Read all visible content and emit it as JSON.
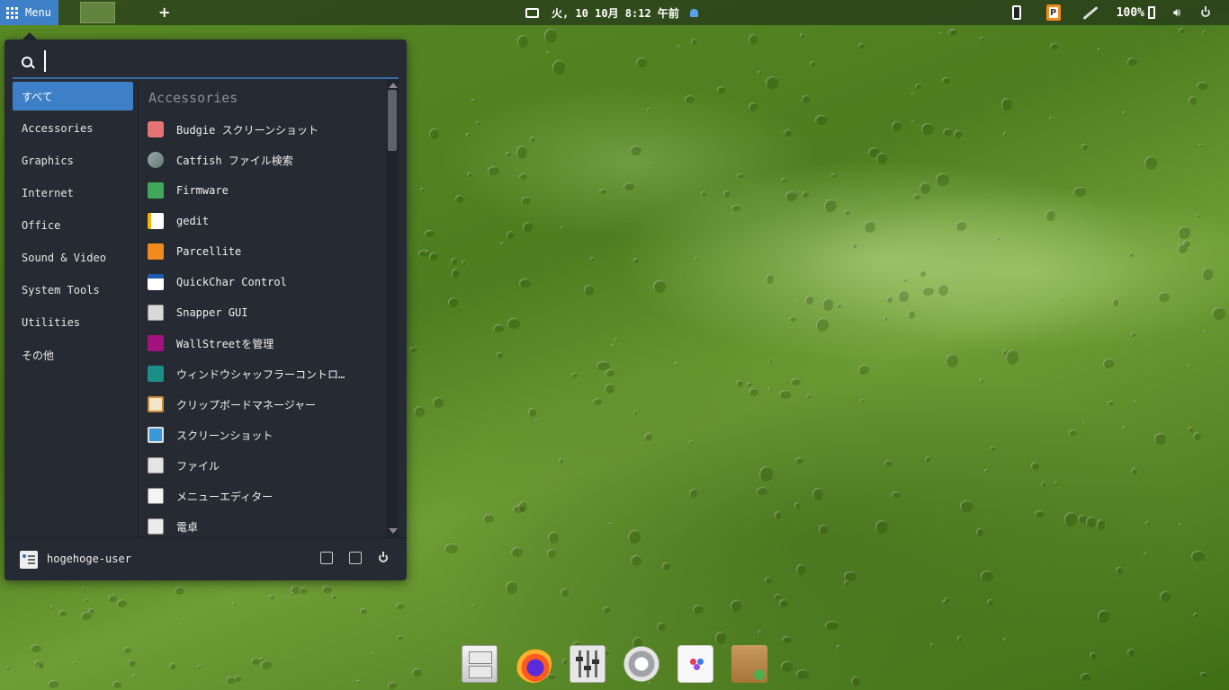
{
  "top_panel": {
    "menu_label": "Menu",
    "clock_text": "火, 10 10月  8:12 午前",
    "battery_text": "100%"
  },
  "menu": {
    "search_placeholder": "",
    "categories": [
      {
        "label": "すべて",
        "active": true
      },
      {
        "label": "Accessories"
      },
      {
        "label": "Graphics"
      },
      {
        "label": "Internet"
      },
      {
        "label": "Office"
      },
      {
        "label": "Sound & Video"
      },
      {
        "label": "System Tools"
      },
      {
        "label": "Utilities"
      },
      {
        "label": "その他"
      }
    ],
    "section_title": "Accessories",
    "apps": [
      {
        "label": "Budgie スクリーンショット",
        "icon": "camera-icon"
      },
      {
        "label": "Catfish ファイル検索",
        "icon": "catfish-icon"
      },
      {
        "label": "Firmware",
        "icon": "firmware-icon"
      },
      {
        "label": "gedit",
        "icon": "text-editor-icon"
      },
      {
        "label": "Parcellite",
        "icon": "parcellite-icon"
      },
      {
        "label": "QuickChar Control",
        "icon": "quickchar-icon"
      },
      {
        "label": "Snapper GUI",
        "icon": "snapper-icon"
      },
      {
        "label": "WallStreetを管理",
        "icon": "wallstreet-icon"
      },
      {
        "label": "ウィンドウシャッフラーコントロ…",
        "icon": "window-shuffler-icon"
      },
      {
        "label": "クリップボードマネージャー",
        "icon": "clipboard-icon"
      },
      {
        "label": "スクリーンショット",
        "icon": "screenshot-icon"
      },
      {
        "label": "ファイル",
        "icon": "files-icon"
      },
      {
        "label": "メニューエディター",
        "icon": "menu-editor-icon"
      },
      {
        "label": "電卓",
        "icon": "calculator-icon"
      }
    ],
    "user_name": "hogehoge-user"
  },
  "dock": [
    "files-icon",
    "firefox-icon",
    "mixer-icon",
    "settings-gear-icon",
    "software-store-icon",
    "package-installer-icon"
  ]
}
